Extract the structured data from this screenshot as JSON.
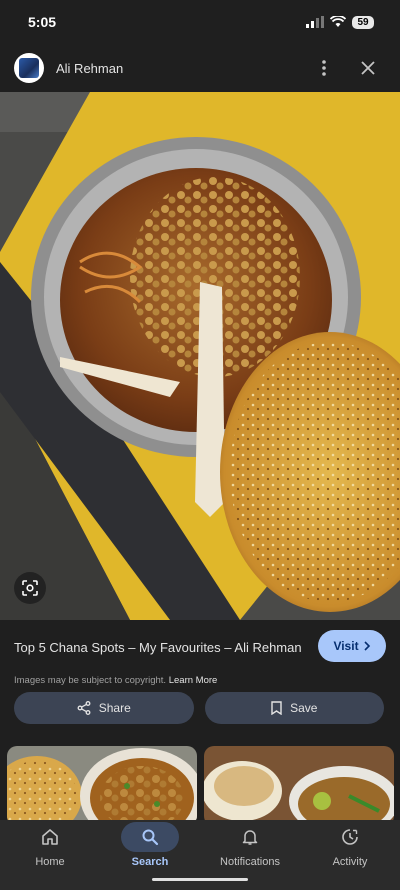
{
  "status": {
    "time": "5:05",
    "battery": "59"
  },
  "header": {
    "author": "Ali Rehman"
  },
  "result": {
    "title": "Top 5 Chana Spots – My Favourites – Ali Rehman",
    "visit_label": "Visit",
    "copyright": "Images may be subject to copyright.",
    "learn_more": "Learn More"
  },
  "actions": {
    "share_label": "Share",
    "save_label": "Save"
  },
  "nav": {
    "items": [
      {
        "label": "Home",
        "icon": "home-icon",
        "active": false
      },
      {
        "label": "Search",
        "icon": "search-icon",
        "active": true
      },
      {
        "label": "Notifications",
        "icon": "bell-icon",
        "active": false
      },
      {
        "label": "Activity",
        "icon": "activity-icon",
        "active": false
      }
    ]
  },
  "colors": {
    "accent": "#a8c7fa",
    "background": "#1f1f1f",
    "button": "#3c4454"
  }
}
